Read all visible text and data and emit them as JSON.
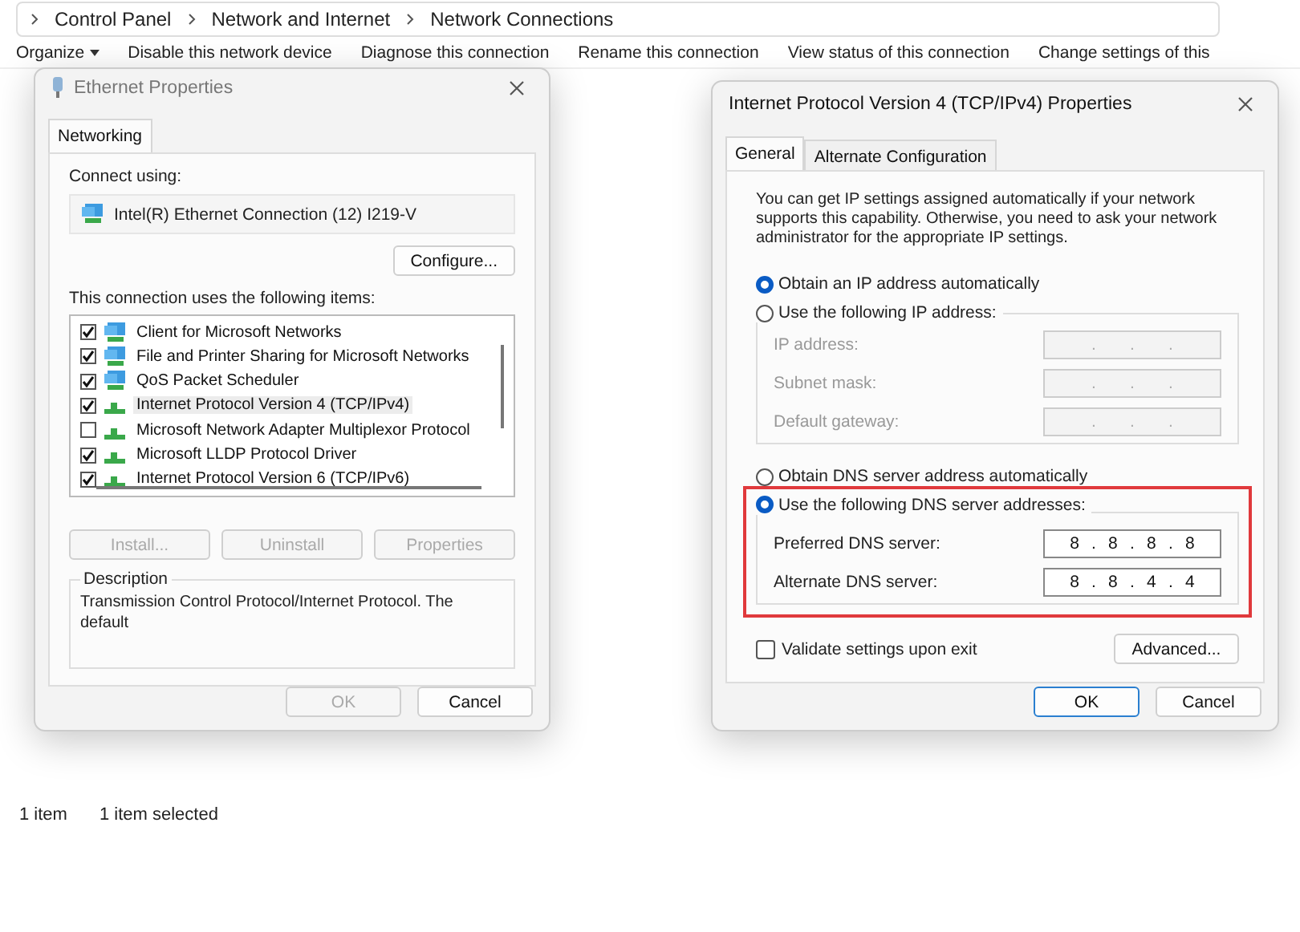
{
  "explorer": {
    "breadcrumb": [
      "Control Panel",
      "Network and Internet",
      "Network Connections"
    ],
    "toolbar": [
      {
        "label": "Organize",
        "kind": "menu"
      },
      {
        "label": "Disable this network device",
        "kind": "action"
      },
      {
        "label": "Diagnose this connection",
        "kind": "action"
      },
      {
        "label": "Rename this connection",
        "kind": "action"
      },
      {
        "label": "View status of this connection",
        "kind": "action"
      },
      {
        "label": "Change settings of this",
        "kind": "action"
      }
    ],
    "status_bar": [
      "1 item",
      "1 item selected"
    ]
  },
  "ethernet_dialog": {
    "title": "Ethernet Properties",
    "tabs": [
      {
        "label": "Networking",
        "selected": true
      }
    ],
    "connect_using_label": "Connect using:",
    "adapter": "Intel(R) Ethernet Connection (12) I219-V",
    "configure_button": "Configure...",
    "items_label": "This connection uses the following items:",
    "items": [
      {
        "label": "Client for Microsoft Networks",
        "checked": true,
        "selected": false,
        "kind": "service"
      },
      {
        "label": "File and Printer Sharing for Microsoft Networks",
        "checked": true,
        "selected": false,
        "kind": "service"
      },
      {
        "label": "QoS Packet Scheduler",
        "checked": true,
        "selected": false,
        "kind": "service"
      },
      {
        "label": "Internet Protocol Version 4 (TCP/IPv4)",
        "checked": true,
        "selected": true,
        "kind": "protocol"
      },
      {
        "label": "Microsoft Network Adapter Multiplexor Protocol",
        "checked": false,
        "selected": false,
        "kind": "protocol"
      },
      {
        "label": "Microsoft LLDP Protocol Driver",
        "checked": true,
        "selected": false,
        "kind": "protocol"
      },
      {
        "label": "Internet Protocol Version 6 (TCP/IPv6)",
        "checked": true,
        "selected": false,
        "kind": "protocol"
      }
    ],
    "item_buttons": [
      {
        "label": "Install...",
        "disabled": true
      },
      {
        "label": "Uninstall",
        "disabled": true
      },
      {
        "label": "Properties",
        "disabled": true
      }
    ],
    "description_title": "Description",
    "description": "Transmission Control Protocol/Internet Protocol. The default",
    "footer_buttons": [
      {
        "label": "OK",
        "disabled": true
      },
      {
        "label": "Cancel",
        "disabled": false
      }
    ]
  },
  "ipv4_dialog": {
    "title": "Internet Protocol Version 4 (TCP/IPv4) Properties",
    "tabs": [
      {
        "label": "General",
        "selected": true
      },
      {
        "label": "Alternate Configuration",
        "selected": false
      }
    ],
    "intro": "You can get IP settings assigned automatically if your network supports this capability. Otherwise, you need to ask your network administrator for the appropriate IP settings.",
    "ip_options": [
      {
        "label": "Obtain an IP address automatically",
        "selected": true
      },
      {
        "label": "Use the following IP address:",
        "selected": false
      }
    ],
    "ip_fields": [
      {
        "label": "IP address:",
        "value": [
          ".",
          ".",
          "."
        ],
        "disabled": true
      },
      {
        "label": "Subnet mask:",
        "value": [
          ".",
          ".",
          "."
        ],
        "disabled": true
      },
      {
        "label": "Default gateway:",
        "value": [
          ".",
          ".",
          "."
        ],
        "disabled": true
      }
    ],
    "dns_options": [
      {
        "label": "Obtain DNS server address automatically",
        "selected": false
      },
      {
        "label": "Use the following DNS server addresses:",
        "selected": true
      }
    ],
    "dns_fields": [
      {
        "label": "Preferred DNS server:",
        "value": [
          "8",
          ".",
          "8",
          ".",
          "8",
          ".",
          "8"
        ],
        "disabled": false
      },
      {
        "label": "Alternate DNS server:",
        "value": [
          "8",
          ".",
          "8",
          ".",
          "4",
          ".",
          "4"
        ],
        "disabled": false
      }
    ],
    "highlight_dns": true,
    "validate": {
      "label": "Validate settings upon exit",
      "checked": false
    },
    "advanced_button": "Advanced...",
    "footer_buttons": [
      {
        "label": "OK",
        "disabled": false,
        "default": true
      },
      {
        "label": "Cancel",
        "disabled": false,
        "default": false
      }
    ]
  }
}
